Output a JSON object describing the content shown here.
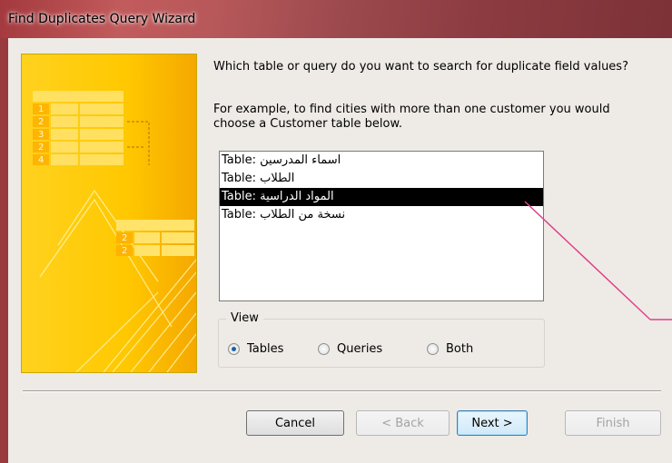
{
  "window": {
    "title": "Find Duplicates Query Wizard"
  },
  "prompt": {
    "question": "Which table or query do you want to search for duplicate field values?",
    "example": "For example, to find cities with more than one customer you would choose a Customer table below."
  },
  "illustration": {
    "row_numbers": [
      "1",
      "2",
      "3",
      "2",
      "4"
    ],
    "result_numbers": [
      "2",
      "2"
    ]
  },
  "tables_list": {
    "items": [
      {
        "prefix": "Table:",
        "name": "اسماء المدرسين",
        "selected": false
      },
      {
        "prefix": "Table:",
        "name": "الطلاب",
        "selected": false
      },
      {
        "prefix": "Table:",
        "name": "المواد الدراسية",
        "selected": true
      },
      {
        "prefix": "Table:",
        "name": "نسخة من الطلاب",
        "selected": false
      }
    ]
  },
  "view": {
    "legend": "View",
    "options": [
      {
        "label": "Tables",
        "selected": true
      },
      {
        "label": "Queries",
        "selected": false
      },
      {
        "label": "Both",
        "selected": false
      }
    ]
  },
  "buttons": {
    "cancel": "Cancel",
    "back": "< Back",
    "next": "Next >",
    "finish": "Finish"
  },
  "colors": {
    "titlebar": "#a3393e",
    "illustration_yellow": "#ffc400",
    "selection": "#000000",
    "annotation_line": "#e0408a"
  }
}
